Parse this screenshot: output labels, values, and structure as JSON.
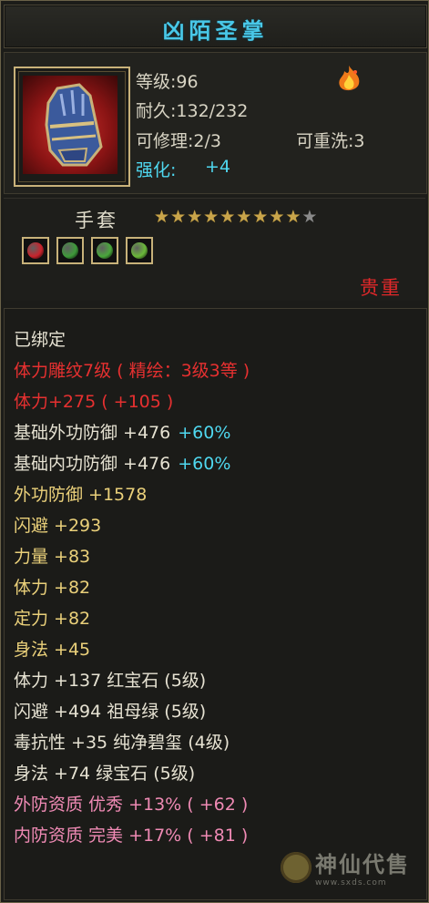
{
  "item": {
    "name": "凶陌圣掌",
    "stats": {
      "level": "等级:96",
      "durability": "耐久:132/232",
      "repairable": "可修理:2/3",
      "rewashable": "可重洗:3",
      "enhance_label": "强化:",
      "enhance_value": "+4"
    },
    "type": "手套",
    "stars": {
      "filled": 9,
      "total": 10
    },
    "gems": [
      {
        "icon": "ruby-gem-icon",
        "color": "#c8232c"
      },
      {
        "icon": "emerald-gem-icon",
        "color": "#3e9a3a"
      },
      {
        "icon": "green-jade-gem-icon",
        "color": "#4aa83c"
      },
      {
        "icon": "green-gem-icon",
        "color": "#6ab83a"
      }
    ],
    "rarity": "贵重"
  },
  "attributes": [
    {
      "text": "已绑定",
      "color": "white"
    },
    {
      "text": "体力雕纹7级 ( 精绘：3级3等 )",
      "color": "red"
    },
    {
      "text": "体力+275 ( +105 )",
      "color": "red"
    },
    {
      "text": "基础外功防御 +476",
      "extra": "+60%",
      "color": "white"
    },
    {
      "text": "基础内功防御 +476",
      "extra": "+60%",
      "color": "white"
    },
    {
      "text": "外功防御 +1578",
      "color": "yellow"
    },
    {
      "text": "闪避 +293",
      "color": "yellow"
    },
    {
      "text": "力量 +83",
      "color": "yellow"
    },
    {
      "text": "体力 +82",
      "color": "yellow"
    },
    {
      "text": "定力 +82",
      "color": "yellow"
    },
    {
      "text": "身法 +45",
      "color": "yellow"
    },
    {
      "text": "体力 +137 红宝石 (5级)",
      "color": "white"
    },
    {
      "text": "闪避 +494 祖母绿 (5级)",
      "color": "white"
    },
    {
      "text": "毒抗性 +35 纯净碧玺 (4级)",
      "color": "white"
    },
    {
      "text": "身法 +74 绿宝石 (5级)",
      "color": "white"
    },
    {
      "text": "外防资质   优秀 +13% ( +62 )",
      "color": "pink"
    },
    {
      "text": "内防资质   完美 +17% ( +81 )",
      "color": "pink"
    }
  ],
  "watermark": {
    "name": "神仙代售",
    "url": "www.sxds.com"
  },
  "colors": {
    "title": "#49c8e8",
    "cyan": "#4fd8f0",
    "red": "#e63030",
    "yellow": "#ead07a",
    "pink": "#ef8ab4",
    "white": "#e6e2d2"
  }
}
